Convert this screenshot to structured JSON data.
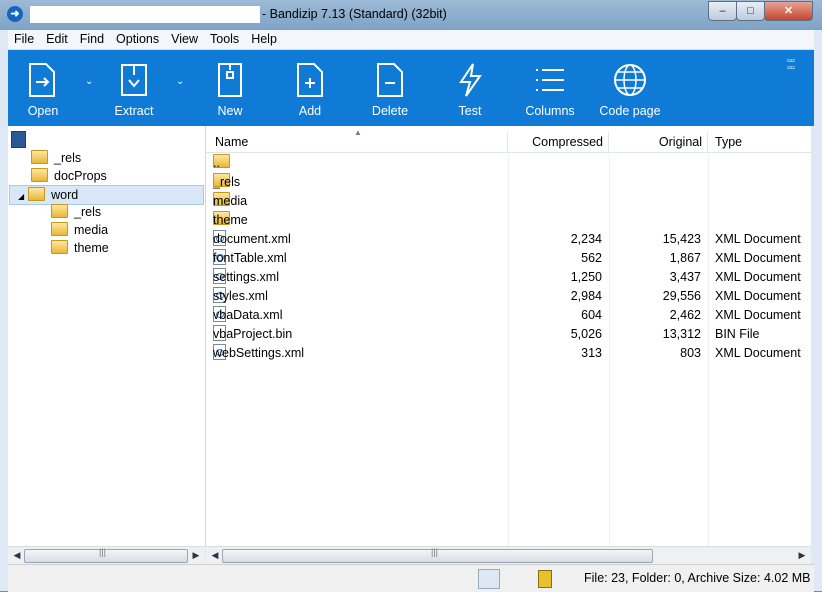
{
  "window": {
    "title": "- Bandizip 7.13 (Standard) (32bit)",
    "controls": {
      "minimize": "–",
      "maximize": "□",
      "close": "✕"
    }
  },
  "menu": [
    "File",
    "Edit",
    "Find",
    "Options",
    "View",
    "Tools",
    "Help"
  ],
  "toolbar": {
    "open": "Open",
    "extract": "Extract",
    "new": "New",
    "add": "Add",
    "delete": "Delete",
    "test": "Test",
    "columns": "Columns",
    "codepage": "Code page"
  },
  "tree": {
    "items": [
      {
        "label": "_rels",
        "level": 1
      },
      {
        "label": "docProps",
        "level": 1
      },
      {
        "label": "word",
        "level": 1,
        "expanded": true,
        "selected": true
      },
      {
        "label": "_rels",
        "level": 2
      },
      {
        "label": "media",
        "level": 2
      },
      {
        "label": "theme",
        "level": 2
      }
    ]
  },
  "list": {
    "columns": [
      "Name",
      "Compressed",
      "Original",
      "Type"
    ],
    "rows": [
      {
        "name": "..",
        "compressed": "",
        "original": "",
        "type": "",
        "kind": "folder"
      },
      {
        "name": "_rels",
        "compressed": "",
        "original": "",
        "type": "",
        "kind": "folder"
      },
      {
        "name": "media",
        "compressed": "",
        "original": "",
        "type": "",
        "kind": "folder"
      },
      {
        "name": "theme",
        "compressed": "",
        "original": "",
        "type": "",
        "kind": "folder"
      },
      {
        "name": "document.xml",
        "compressed": "2,234",
        "original": "15,423",
        "type": "XML Document",
        "kind": "xml"
      },
      {
        "name": "fontTable.xml",
        "compressed": "562",
        "original": "1,867",
        "type": "XML Document",
        "kind": "xml"
      },
      {
        "name": "settings.xml",
        "compressed": "1,250",
        "original": "3,437",
        "type": "XML Document",
        "kind": "xml"
      },
      {
        "name": "styles.xml",
        "compressed": "2,984",
        "original": "29,556",
        "type": "XML Document",
        "kind": "xml"
      },
      {
        "name": "vbaData.xml",
        "compressed": "604",
        "original": "2,462",
        "type": "XML Document",
        "kind": "xml"
      },
      {
        "name": "vbaProject.bin",
        "compressed": "5,026",
        "original": "13,312",
        "type": "BIN File",
        "kind": "bin"
      },
      {
        "name": "webSettings.xml",
        "compressed": "313",
        "original": "803",
        "type": "XML Document",
        "kind": "xml"
      }
    ]
  },
  "status": {
    "text": "File: 23, Folder: 0, Archive Size: 4.02 MB"
  },
  "colors": {
    "toolbar": "#0f7bd6",
    "selection": "#d9e8f8"
  }
}
